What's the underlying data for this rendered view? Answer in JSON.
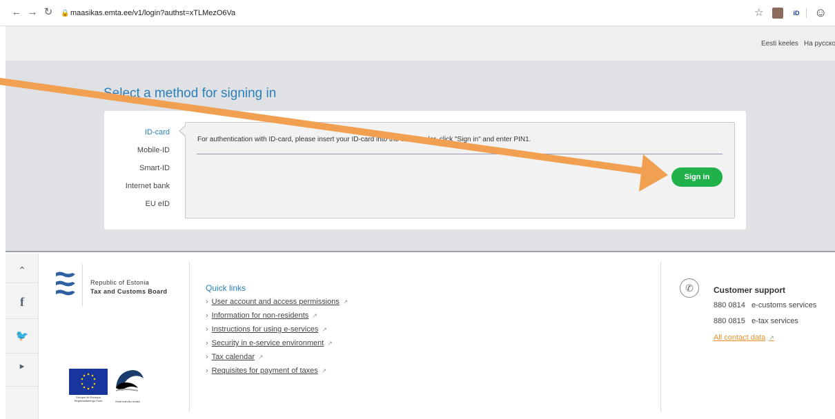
{
  "browser": {
    "url": "maasikas.emta.ee/v1/login?authst=xTLMezO6Va",
    "ext_id_label": "iD"
  },
  "languages": [
    "Eesti keeles",
    "На русско"
  ],
  "page_title": "Select a method for signing in",
  "methods": [
    "ID-card",
    "Mobile-ID",
    "Smart-ID",
    "Internet bank",
    "EU eID"
  ],
  "active_method": "ID-card",
  "panel": {
    "instruction": "For authentication with ID-card, please insert your ID-card into the card reader, click \"Sign in\" and enter PIN1.",
    "signin_label": "Sign in"
  },
  "organization": {
    "line1": "Republic of Estonia",
    "line2": "Tax and Customs Board"
  },
  "quick_links": {
    "title": "Quick links",
    "items": [
      "User account and access permissions",
      "Information for non-residents",
      "Instructions for using e-services",
      "Security in e-service environment",
      "Tax calendar",
      "Requisites for payment of taxes"
    ]
  },
  "support": {
    "title": "Customer support",
    "phones": [
      {
        "number": "880 0814",
        "label": "e-customs services"
      },
      {
        "number": "880 0815",
        "label": "e-tax services"
      }
    ],
    "contact_link": "All contact data"
  },
  "eu_logo": {
    "text": "Europa Liit Euroopa Regionaalarengu Fond"
  },
  "estonia_logo": {
    "text": "Eesti tuleviku heaks"
  },
  "colors": {
    "accent_blue": "#2a7fb8",
    "sign_in_green": "#20b14a",
    "annotation_orange": "#f0a050",
    "link_orange": "#e8922a"
  }
}
